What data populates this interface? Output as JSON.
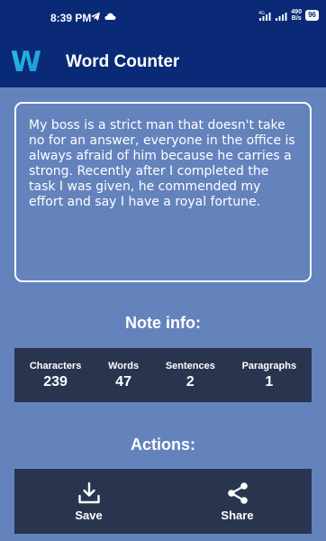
{
  "status_bar": {
    "time": "8:39 PM",
    "icons": [
      "location-arrow-icon",
      "telegram-icon",
      "cloud-icon"
    ],
    "network_label": "4G",
    "speed_value": "490",
    "speed_unit": "B/s",
    "battery": "96"
  },
  "app_bar": {
    "logo_letter": "W",
    "title": "Word Counter"
  },
  "note": {
    "text": "My boss is a strict man that doesn't take no for an answer, everyone in the office is always afraid of him because he carries a strong. Recently after I completed the task I was given, he commended my effort and say I have a royal fortune."
  },
  "note_info": {
    "title": "Note info:",
    "stats": [
      {
        "label": "Characters",
        "value": "239"
      },
      {
        "label": "Words",
        "value": "47"
      },
      {
        "label": "Sentences",
        "value": "2"
      },
      {
        "label": "Paragraphs",
        "value": "1"
      }
    ]
  },
  "actions": {
    "title": "Actions:",
    "save_label": "Save",
    "share_label": "Share"
  },
  "colors": {
    "background": "#6483bd",
    "app_bar": "#0a2a78",
    "panel": "#29344f",
    "text": "#ffffff"
  }
}
